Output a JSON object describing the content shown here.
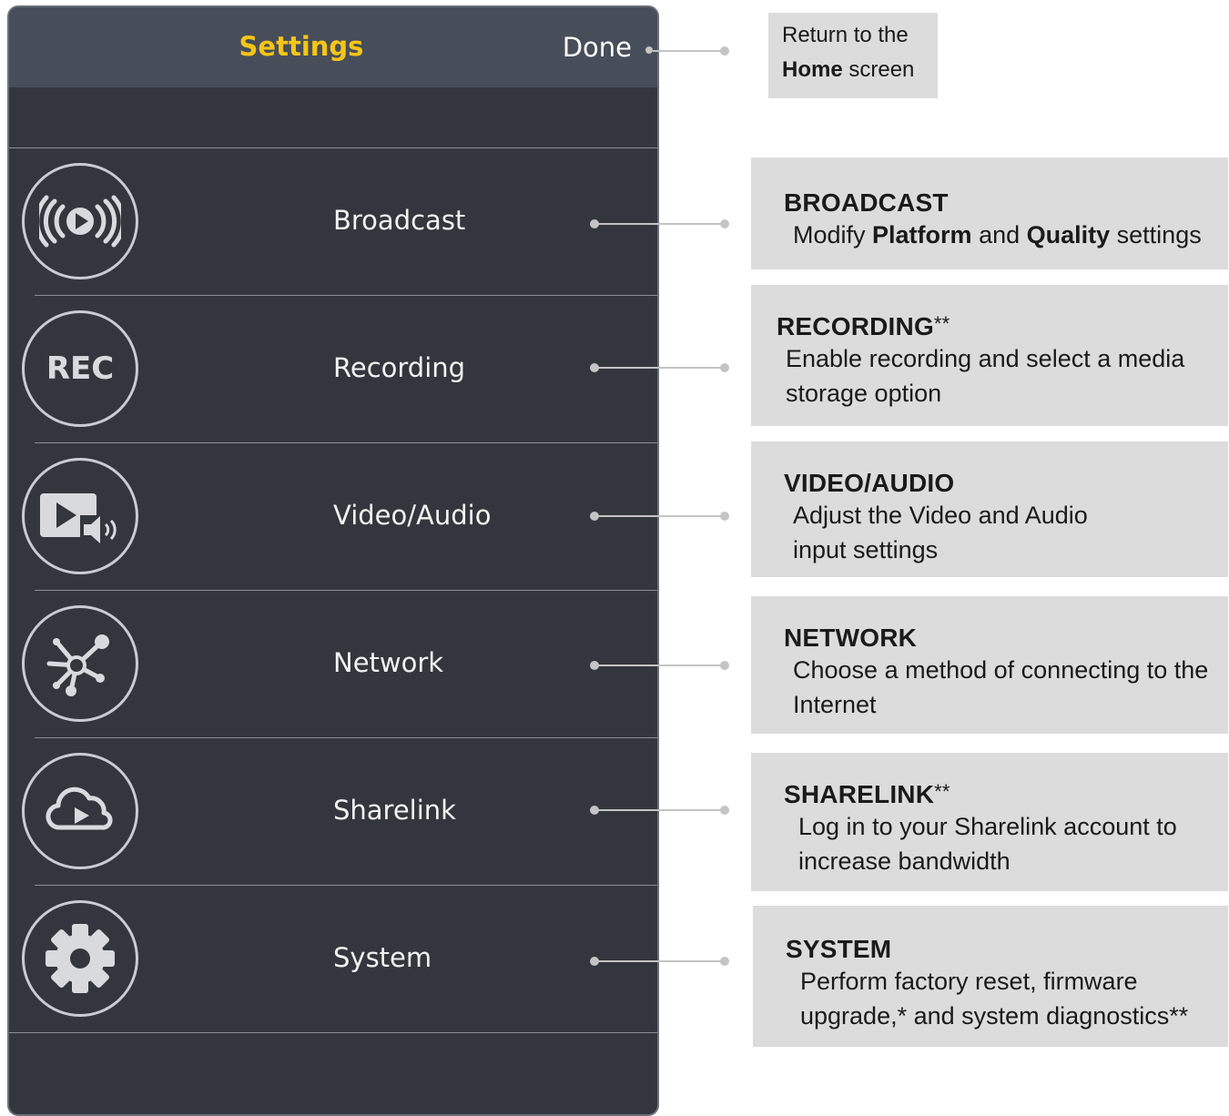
{
  "navbar": {
    "title": "Settings",
    "done_label": "Done"
  },
  "menu": [
    {
      "label": "Broadcast",
      "icon": "broadcast-icon"
    },
    {
      "label": "Recording",
      "icon": "rec-icon",
      "icon_text": "REC"
    },
    {
      "label": "Video/Audio",
      "icon": "video-audio-icon"
    },
    {
      "label": "Network",
      "icon": "network-icon"
    },
    {
      "label": "Sharelink",
      "icon": "cloud-play-icon"
    },
    {
      "label": "System",
      "icon": "gear-icon"
    }
  ],
  "home_callout": {
    "line1": "Return to the",
    "bold": "Home",
    "rest": " screen"
  },
  "callouts": {
    "broadcast": {
      "heading": "BROADCAST",
      "pre": "Modify ",
      "b1": "Platform",
      "mid": " and ",
      "b2": "Quality",
      "post": " settings"
    },
    "recording": {
      "heading": "RECORDING",
      "stars": "**",
      "desc": "Enable recording and select a media storage option"
    },
    "video_audio": {
      "heading": "VIDEO/AUDIO",
      "desc": "Adjust the Video and Audio input settings"
    },
    "network": {
      "heading": "NETWORK",
      "desc": "Choose a method of connecting to the Internet"
    },
    "sharelink": {
      "heading": "SHARELINK",
      "stars": "**",
      "desc": "Log in to your Sharelink account to increase bandwidth"
    },
    "system": {
      "heading": "SYSTEM",
      "desc": "Perform factory reset, firmware upgrade,* and system diagnostics**"
    }
  },
  "colors": {
    "accent": "#f5c518",
    "panel": "#33373d",
    "navbar": "#474e59",
    "callout_bg": "#dcdcdc"
  }
}
